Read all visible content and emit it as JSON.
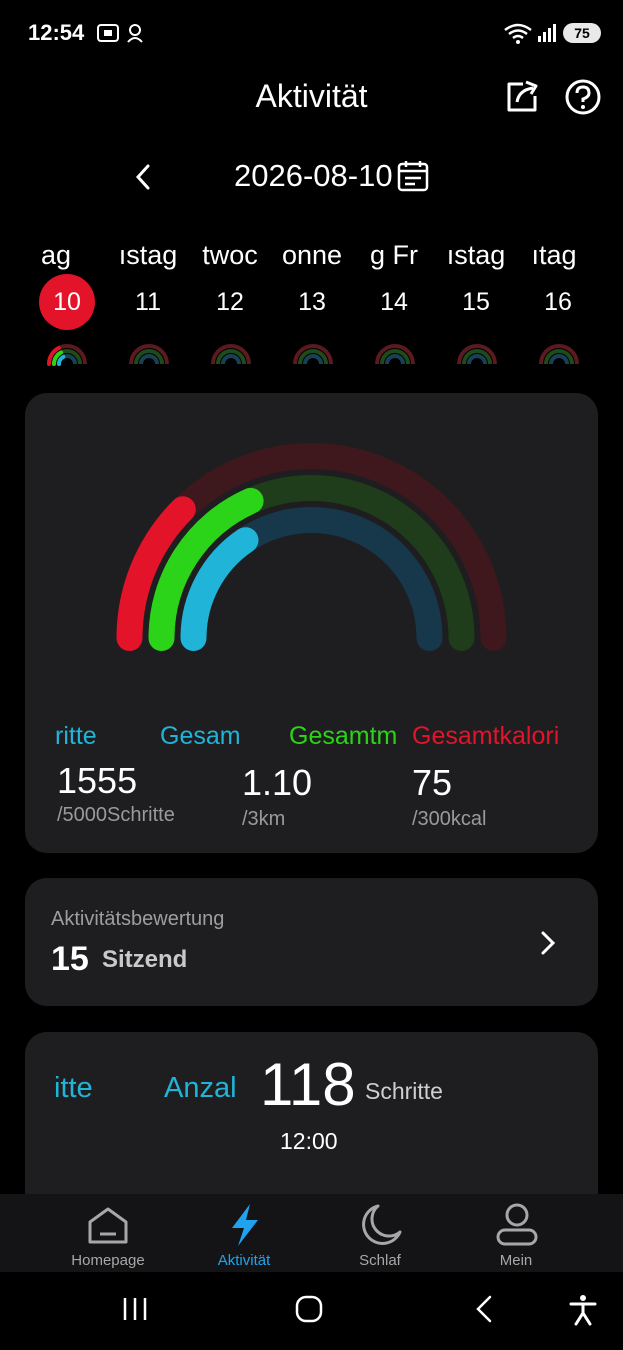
{
  "status_bar": {
    "time": "12:54",
    "battery": "75"
  },
  "header": {
    "title": "Aktivität"
  },
  "date_bar": {
    "date": "2026-08-10"
  },
  "week": {
    "days": [
      {
        "name": "ag",
        "num": "10"
      },
      {
        "name": "ıstag",
        "num": "11"
      },
      {
        "name": "twoc",
        "num": "12"
      },
      {
        "name": "onne",
        "num": "13"
      },
      {
        "name": "g Fr",
        "num": "14"
      },
      {
        "name": "ıstag",
        "num": "15"
      },
      {
        "name": "ıtag",
        "num": "16"
      }
    ]
  },
  "rings": {
    "colors": {
      "steps": "#1fb4d8",
      "distance": "#2bd418",
      "calories": "#e3132a"
    },
    "progress": {
      "steps": 0.311,
      "distance": 0.367,
      "calories": 0.25
    }
  },
  "stats": [
    {
      "label": "ritte",
      "value": "1555",
      "goal": "/5000Schritte",
      "color": "#1fb4d8"
    },
    {
      "label": "Gesam",
      "value": "1.10",
      "goal": "/3km",
      "color": "#1fb4d8"
    },
    {
      "label": "Gesamtm",
      "value": "",
      "goal": "",
      "color": "#2bd418"
    },
    {
      "label": "Gesamtkalori",
      "value": "75",
      "goal": "/300kcal",
      "color": "#e3132a"
    }
  ],
  "score_card": {
    "title": "Aktivitätsbewertung",
    "score": "15",
    "level": "Sitzend"
  },
  "detail_card": {
    "tab1": "itte",
    "tab2": "Anzal",
    "big_value": "118",
    "unit": "Schritte",
    "time": "12:00"
  },
  "bottom_nav": {
    "items": [
      {
        "label": "Homepage",
        "icon": "home-icon"
      },
      {
        "label": "Aktivität",
        "icon": "lightning-icon",
        "active": true
      },
      {
        "label": "Schlaf",
        "icon": "moon-icon"
      },
      {
        "label": "Mein",
        "icon": "person-icon"
      }
    ]
  }
}
